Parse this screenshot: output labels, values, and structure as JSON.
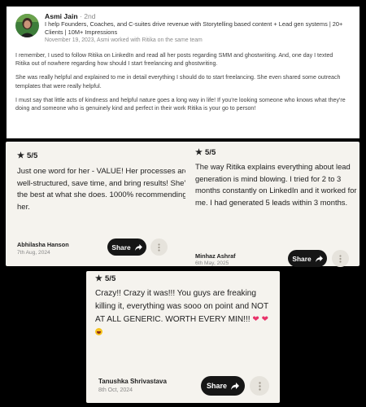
{
  "linkedin": {
    "name": "Asmi Jain",
    "degree": "· 2nd",
    "headline": "I help Founders, Coaches, and C-suites drive revenue with Storytelling based content + Lead gen systems | 20+ Clients | 10M+ Impressions",
    "date_line": "November 19, 2023, Asmi worked with Ritika on the same team",
    "paragraphs": [
      "I remember, I used to follow Ritika on LinkedIn and read all her posts regarding SMM and ghostwriting. And, one day I texted Ritika out of nowhere regarding how should I start freelancing and ghostwriting.",
      "She was really helpful and explained to me in detail everything I should do to start freelancing. She even shared some outreach templates that were really helpful.",
      "I must say that little acts of kindness and helpful nature goes a long way in life! If you're looking someone who knows what they're doing and someone who is genuinely kind and perfect in their work Ritika is your go to person!"
    ]
  },
  "testimonials": [
    {
      "rating": "5/5",
      "text": "Just one word for her - VALUE! Her processes are well-structured, save time, and bring results! She's the best at what she does. 1000% recommending her.",
      "author": "Abhilasha Hanson",
      "date": "7th Aug, 2024",
      "share_label": "Share"
    },
    {
      "rating": "5/5",
      "text": "The way Ritika explains everything about lead generation is mind blowing. I tried for 2 to 3 months constantly on LinkedIn and it worked for me. I had generated 5 leads within 3 months.",
      "author": "Minhaz Ashraf",
      "date": "6th May, 2025",
      "share_label": "Share"
    },
    {
      "rating": "5/5",
      "text": "Crazy!! Crazy it was!!! You guys are freaking killing it, everything was sooo on point and NOT AT ALL GENERIC. WORTH EVERY MIN!!!",
      "emoji": "❤ ❤",
      "author": "Tanushka Shrivastava",
      "date": "8th Oct, 2024",
      "share_label": "Share"
    }
  ],
  "colors": {
    "card_bg": "#f5f3ee",
    "share_bg": "#161616",
    "heart": "#e8336a"
  },
  "icons": [
    "star-icon",
    "share-arrow-icon",
    "more-dots-icon",
    "heart-icon",
    "grin-emoji-icon"
  ]
}
